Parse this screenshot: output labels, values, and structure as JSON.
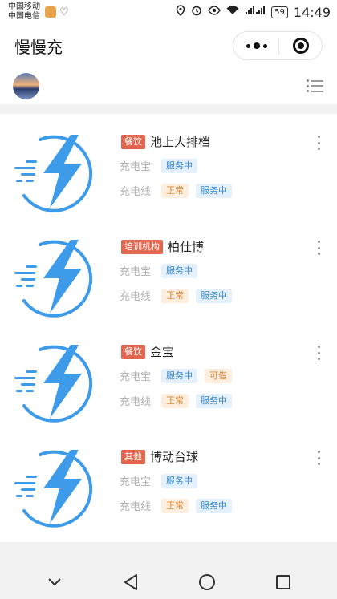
{
  "status_bar": {
    "carrier_1": "中国移动",
    "carrier_2": "中国电信",
    "battery": "59",
    "time": "14:49",
    "icons": [
      "location-icon",
      "alarm-icon",
      "eye-icon",
      "wifi-icon",
      "signal-icon",
      "battery-icon"
    ]
  },
  "header": {
    "title": "慢慢充"
  },
  "shops": [
    {
      "category": "餐饮",
      "name": "池上大排档",
      "devices": [
        {
          "label": "充电宝",
          "badges": [
            {
              "text": "服务中",
              "color": "blue"
            }
          ]
        },
        {
          "label": "充电线",
          "badges": [
            {
              "text": "正常",
              "color": "orange"
            },
            {
              "text": "服务中",
              "color": "blue"
            }
          ]
        }
      ]
    },
    {
      "category": "培训机构",
      "name": "柏仕博",
      "devices": [
        {
          "label": "充电宝",
          "badges": [
            {
              "text": "服务中",
              "color": "blue"
            }
          ]
        },
        {
          "label": "充电线",
          "badges": [
            {
              "text": "正常",
              "color": "orange"
            },
            {
              "text": "服务中",
              "color": "blue"
            }
          ]
        }
      ]
    },
    {
      "category": "餐饮",
      "name": "金宝",
      "devices": [
        {
          "label": "充电宝",
          "badges": [
            {
              "text": "服务中",
              "color": "blue"
            },
            {
              "text": "可借",
              "color": "orange"
            }
          ]
        },
        {
          "label": "充电线",
          "badges": [
            {
              "text": "正常",
              "color": "orange"
            },
            {
              "text": "服务中",
              "color": "blue"
            }
          ]
        }
      ]
    },
    {
      "category": "其他",
      "name": "博动台球",
      "devices": [
        {
          "label": "充电宝",
          "badges": [
            {
              "text": "服务中",
              "color": "blue"
            }
          ]
        },
        {
          "label": "充电线",
          "badges": [
            {
              "text": "正常",
              "color": "orange"
            },
            {
              "text": "服务中",
              "color": "blue"
            }
          ]
        }
      ]
    }
  ],
  "colors": {
    "brand_blue": "#3d9be9",
    "category_tag": "#e2664f",
    "badge_blue_text": "#3b88d0",
    "badge_orange_text": "#d9883b"
  }
}
